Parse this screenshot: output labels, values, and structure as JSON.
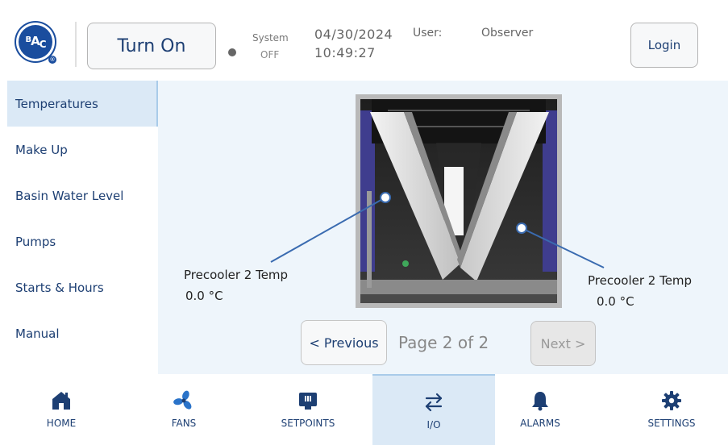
{
  "header": {
    "logo_text": "BAC",
    "turn_on_label": "Turn On",
    "system_label": "System",
    "system_state": "OFF",
    "date": "04/30/2024",
    "time": "10:49:27",
    "user_label": "User:",
    "user_value": "Observer",
    "login_label": "Login"
  },
  "sidebar": {
    "items": [
      {
        "label": "Temperatures",
        "active": true
      },
      {
        "label": "Make Up"
      },
      {
        "label": "Basin Water Level"
      },
      {
        "label": "Pumps"
      },
      {
        "label": "Starts & Hours"
      },
      {
        "label": "Manual"
      }
    ]
  },
  "main": {
    "callout_left": {
      "label": "Precooler 2 Temp",
      "value": "0.0  °C"
    },
    "callout_right": {
      "label": "Precooler 2 Temp",
      "value": "0.0  °C"
    },
    "prev_label": "< Previous",
    "page_indicator": "Page 2 of 2",
    "next_label": "Next >"
  },
  "bottom_nav": [
    {
      "label": "HOME",
      "icon": "home-icon"
    },
    {
      "label": "FANS",
      "icon": "fan-icon"
    },
    {
      "label": "SETPOINTS",
      "icon": "setpoints-icon"
    },
    {
      "label": "I/O",
      "icon": "io-arrows-icon",
      "active": true
    },
    {
      "label": "ALARMS",
      "icon": "bell-icon"
    },
    {
      "label": "SETTINGS",
      "icon": "gear-icon"
    }
  ],
  "colors": {
    "accent": "#1d3f73",
    "active_bg": "#dbe9f6",
    "main_bg": "#eef5fb",
    "callout_line": "#3a6bb0"
  }
}
